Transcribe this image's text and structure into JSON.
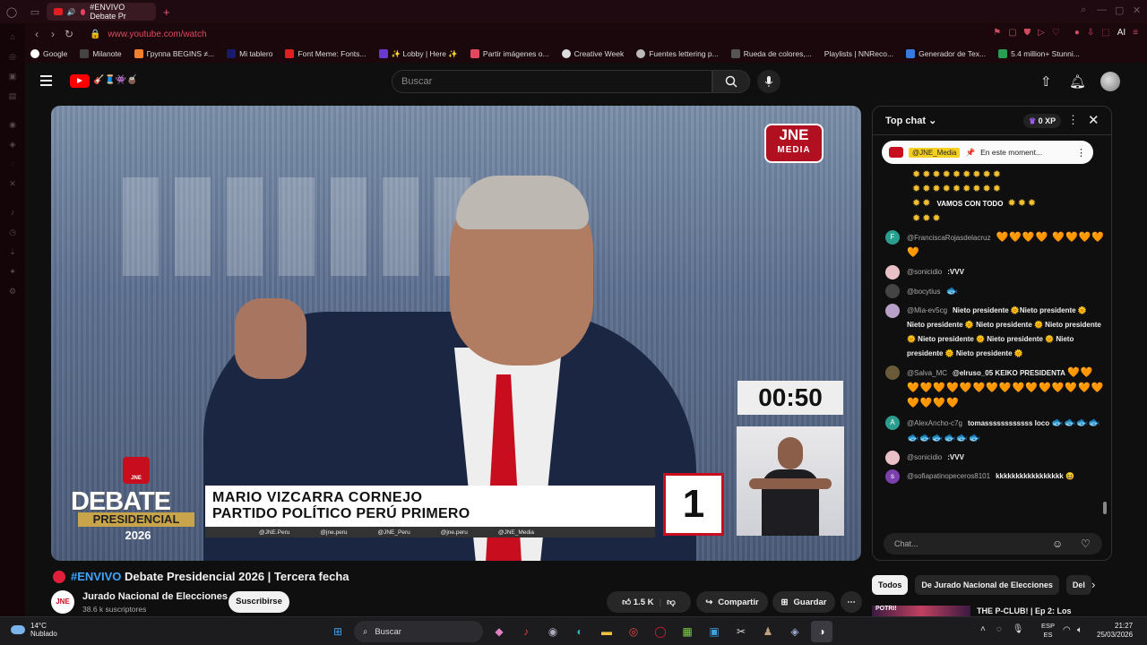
{
  "browser": {
    "tab_title": "#ENVIVO Debate Pr",
    "url": "www.youtube.com/watch",
    "ai_label": "AI",
    "bookmarks": [
      "Google",
      "Milanote",
      "Группа BEGINS ≠...",
      "Mi tablero",
      "Font Meme: Fonts...",
      "✨ Lobby | Here ✨",
      "Partir imágenes o...",
      "Creative Week",
      "Fuentes lettering p...",
      "Rueda de colores,...",
      "Playlists | NNReco...",
      "Generador de Tex...",
      "5.4 million+ Stunni..."
    ]
  },
  "youtube": {
    "search_placeholder": "Buscar",
    "doodle": "🎸🧵👾🧉"
  },
  "video": {
    "jne_logo": "JNE",
    "jne_media": "MEDIA",
    "timer": "00:50",
    "candidate_name": "MARIO VIZCARRA CORNEJO",
    "candidate_party": "PARTIDO POLÍTICO PERÚ PRIMERO",
    "social_handles": [
      "@JNE.Peru",
      "@jne.peru",
      "@JNE_Peru",
      "@jne.peru",
      "@JNE_Media"
    ],
    "candidate_number": "1",
    "debate_jne": "JNE",
    "debate_word": "DEBATE",
    "presidencial_word": "PRESIDENCIAL",
    "year": "2026"
  },
  "chat": {
    "mode": "Top chat",
    "xp": "0 XP",
    "pinned_channel": "@JNE_Media",
    "pinned_text": "En este moment...",
    "emoji_intro_text": "VAMOS CON TODO",
    "messages": [
      {
        "author": "@FranciscaRojasdelacruz",
        "text": "",
        "emoji": "🧡🧡🧡🧡 🧡🧡🧡🧡🧡",
        "avatar": "F",
        "avatar_color": "#2a9d8f"
      },
      {
        "author": "@sonicidio",
        "text": ":VVV",
        "emoji": "",
        "avatar": "",
        "avatar_color": "#e8c0c8"
      },
      {
        "author": "@bocytius",
        "text": "",
        "emoji": "🐟",
        "avatar": "",
        "avatar_color": "#444"
      },
      {
        "author": "@Mia-ev5cg",
        "text": "Nieto presidente 🌞Nieto presidente 🌞 Nieto presidente 🌞 Nieto presidente 🌞 Nieto presidente 🌞 Nieto presidente 🌞 Nieto presidente 🌞 Nieto presidente 🌞 Nieto presidente 🌞",
        "emoji": "",
        "avatar": "",
        "avatar_color": "#b8a0c8"
      },
      {
        "author": "@Salva_MC",
        "text": "@elruso_05 KEIKO PRESIDENTA",
        "emoji": "🧡🧡🧡🧡🧡🧡🧡🧡🧡🧡🧡🧡🧡🧡🧡🧡🧡🧡🧡🧡🧡",
        "avatar": "",
        "avatar_color": "#6a5a3a"
      },
      {
        "author": "@AlexAncho-c7g",
        "text": "tomassssssssssss loco",
        "emoji": "🐟🐟🐟🐟🐟🐟🐟🐟🐟🐟",
        "avatar": "A",
        "avatar_color": "#2a9d8f"
      },
      {
        "author": "@sonicidio",
        "text": ":VVV",
        "emoji": "",
        "avatar": "",
        "avatar_color": "#e8c0c8"
      },
      {
        "author": "@sofiapatinopeceros8101",
        "text": "kkkkkkkkkkkkkkkkk",
        "emoji": "😆",
        "avatar": "s",
        "avatar_color": "#7b3fb0"
      }
    ],
    "input_placeholder": "Chat..."
  },
  "watch": {
    "title_tag": "#ENVIVO",
    "title": "Debate Presidencial 2026 | Tercera fecha",
    "channel_name": "Jurado Nacional de Elecciones",
    "channel_subs": "38.6 k suscriptores",
    "channel_avatar": "JNE",
    "subscribe_label": "Suscribirse",
    "likes": "1.5 K",
    "share_label": "Compartir",
    "save_label": "Guardar",
    "chips": [
      "Todos",
      "De Jurado Nacional de Elecciones",
      "Del"
    ],
    "rec_thumb_text": "POTRI!",
    "rec_title": "THE P-CLUB! | Ep 2: Los"
  },
  "taskbar": {
    "temp": "14°C",
    "condition": "Nublado",
    "search_label": "Buscar",
    "lang_top": "ESP",
    "lang_bottom": "ES",
    "time": "21:27",
    "date": "25/03/2026"
  }
}
